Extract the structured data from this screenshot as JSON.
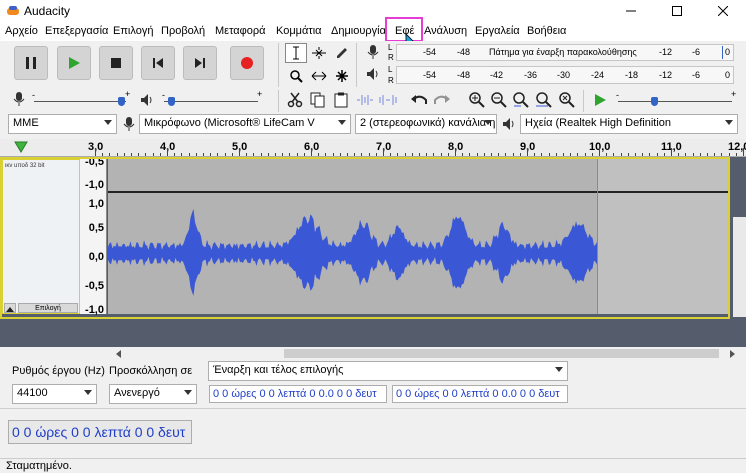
{
  "window": {
    "title": "Audacity"
  },
  "menu": {
    "items": [
      "Αρχείο",
      "Επεξεργασία",
      "Επιλογή",
      "Προβολή",
      "Μεταφορά",
      "Κομμάτια",
      "Δημιουργία",
      "Εφέ",
      "Ανάλυση",
      "Εργαλεία",
      "Βοήθεια"
    ],
    "highlighted": "Εφέ",
    "highlight_color": "#e83cd6"
  },
  "transport": {
    "buttons": [
      "pause-icon",
      "play-icon",
      "stop-icon",
      "skip-start-icon",
      "skip-end-icon",
      "record-icon"
    ],
    "play_color": "#2fa52f",
    "record_color": "#e52121"
  },
  "meters": {
    "record_scale": [
      "-54",
      "-48",
      "Πάτημα για έναρξη παρακολούθησης",
      "-12",
      "-6",
      "0"
    ],
    "play_scale": [
      "-54",
      "-48",
      "-42",
      "-36",
      "-30",
      "-24",
      "-18",
      "-12",
      "-6",
      "0"
    ],
    "record_channels": [
      "L",
      "R"
    ],
    "play_channels": [
      "L",
      "R"
    ]
  },
  "device": {
    "host": "MME",
    "input": "Μικρόφωνο (Microsoft® LifeCam V",
    "channels": "2 (στερεοφωνικά) κανάλια η",
    "output": "Ηχεία (Realtek High Definition"
  },
  "ruler": {
    "labels": [
      "3,0",
      "4,0",
      "5,0",
      "6,0",
      "7,0",
      "8,0",
      "9,0",
      "10,0",
      "11,0",
      "12,0"
    ]
  },
  "track": {
    "info": "ικν uπoδ 32 bit",
    "select_label": "Επιλογή",
    "vruler_top": [
      "-0,5",
      "-1,0"
    ],
    "vruler_main": [
      "1,0",
      "0,5",
      "0,0",
      "-0,5",
      "-1,0"
    ],
    "wave_color": "#3a57d6"
  },
  "selection": {
    "rate_label": "Ρυθμός έργου (Hz)",
    "snap_label": "Προσκόλληση σε",
    "mode": "Έναρξη και τέλος επιλογής",
    "rate_value": "44100",
    "snap_value": "Ανενεργό",
    "start_time": "0 0 ώρες 0 0 λεπτά 0 0.0 0 0 δευτ",
    "end_time": "0 0 ώρες 0 0 λεπτά 0 0.0 0 0 δευτ",
    "audio_position": "0 0 ώρες 0 0 λεπτά 0 0 δευτ"
  },
  "status": {
    "text": "Σταματημένο."
  }
}
